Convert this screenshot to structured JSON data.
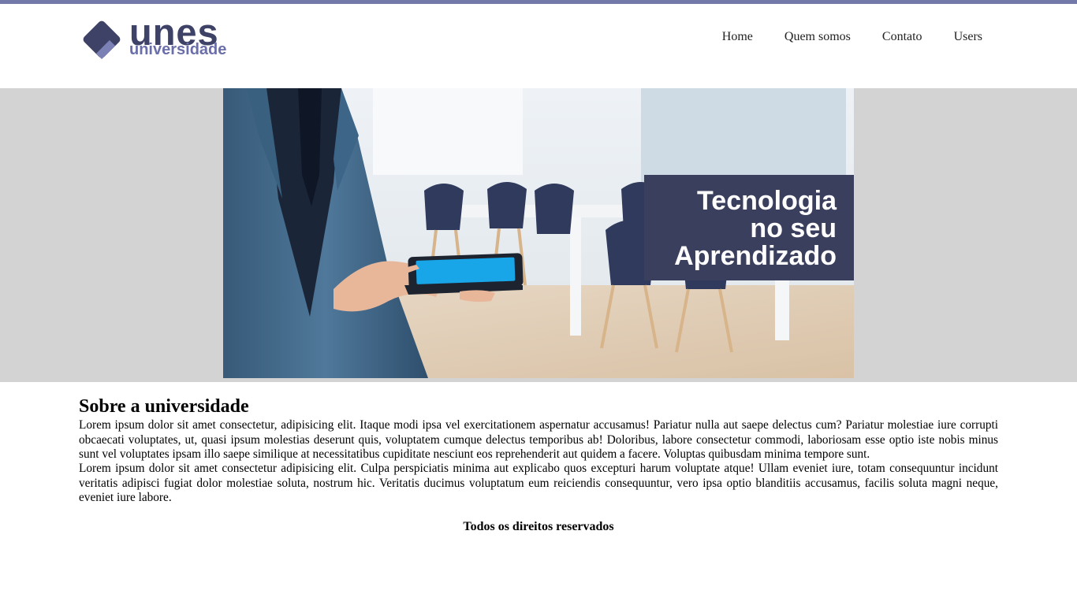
{
  "colors": {
    "accent_bar": "#7379a8",
    "brand_dark": "#3d4266",
    "brand_light": "#6b6fa9",
    "hero_bg": "#d3d3d3"
  },
  "logo": {
    "word_main": "unes",
    "word_sub": "universidade"
  },
  "nav": {
    "items": [
      "Home",
      "Quem somos",
      "Contato",
      "Users"
    ]
  },
  "banner": {
    "line1": "Tecnologia",
    "line2": "no seu",
    "line3": "Aprendizado"
  },
  "about": {
    "title": "Sobre a universidade",
    "paragraph1": "Lorem ipsum dolor sit amet consectetur, adipisicing elit. Itaque modi ipsa vel exercitationem aspernatur accusamus! Pariatur nulla aut saepe delectus cum? Pariatur molestiae iure corrupti obcaecati voluptates, ut, quasi ipsum molestias deserunt quis, voluptatem cumque delectus temporibus ab! Doloribus, labore consectetur commodi, laboriosam esse optio iste nobis minus sunt vel voluptates ipsam illo saepe similique at necessitatibus cupiditate nesciunt eos reprehenderit aut quidem a facere. Voluptas quibusdam minima tempore sunt.",
    "paragraph2": "Lorem ipsum dolor sit amet consectetur adipisicing elit. Culpa perspiciatis minima aut explicabo quos excepturi harum voluptate atque! Ullam eveniet iure, totam consequuntur incidunt veritatis adipisci fugiat dolor molestiae soluta, nostrum hic. Veritatis ducimus voluptatum eum reiciendis consequuntur, vero ipsa optio blanditiis accusamus, facilis soluta magni neque, eveniet iure labore."
  },
  "footer": {
    "text": "Todos os direitos reservados"
  }
}
